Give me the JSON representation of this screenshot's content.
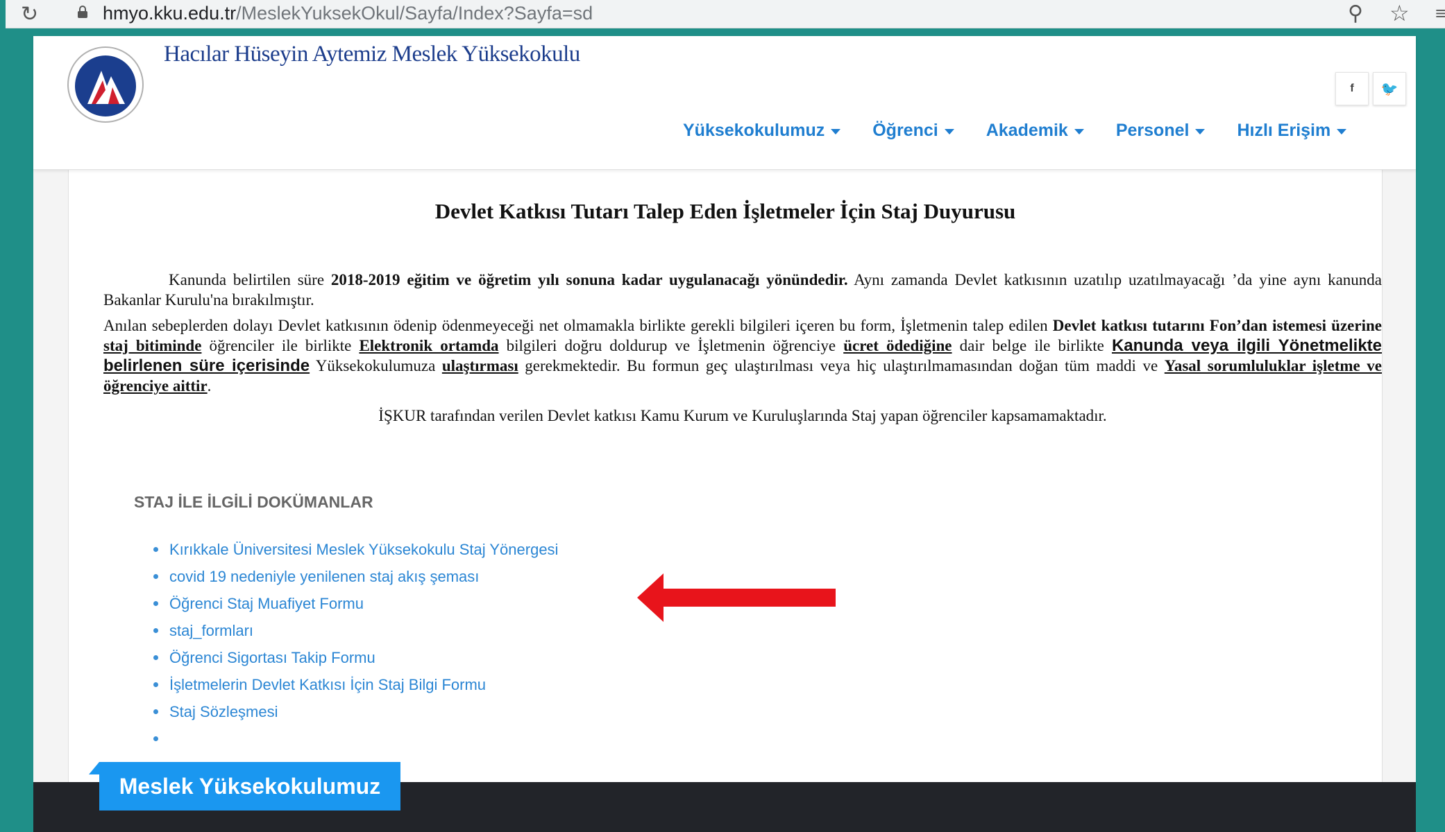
{
  "browser": {
    "url_host": "hmyo.kku.edu.tr",
    "url_path": "/MeslekYuksekOkul/Sayfa/Index?Sayfa=sd",
    "reload_icon": "reload-icon",
    "zoom_icon": "zoom-icon",
    "star_icon": "star-icon"
  },
  "header": {
    "school_name": "Hacılar Hüseyin Aytemiz Meslek Yüksekokulu",
    "social": {
      "facebook": "f",
      "twitter": "🐦"
    },
    "nav": [
      {
        "label": "Yüksekokulumuz"
      },
      {
        "label": "Öğrenci"
      },
      {
        "label": "Akademik"
      },
      {
        "label": "Personel"
      },
      {
        "label": "Hızlı Erişim"
      }
    ]
  },
  "content": {
    "title": "Devlet Katkısı Tutarı Talep Eden İşletmeler İçin Staj Duyurusu",
    "p1": {
      "a": "Kanunda belirtilen süre ",
      "b": "2018-2019 eğitim ve öğretim yılı sonuna kadar uygulanacağı yönündedir.",
      "c": " Aynı zamanda Devlet katkısının uzatılıp uzatılmayacağı ’da yine aynı kanunda Bakanlar Kurulu'na bırakılmıştır."
    },
    "p2": {
      "a": "Anılan sebeplerden dolayı Devlet katkısının ödenip ödenmeyeceği net olmamakla birlikte gerekli  bilgileri içeren bu form, İşletmenin talep edilen ",
      "b": "Devlet katkısı tutarını Fon’dan istemesi üzerine",
      "c": " staj bitiminde",
      "d": " öğrenciler ile birlikte ",
      "e": "Elektronik ortamda",
      "f": " bilgileri doğru doldurup ve İşletmenin öğrenciye ",
      "g": "ücret ödediğine",
      "h": " dair belge ile birlikte ",
      "i": "Kanunda veya ilgili Yönetmelikte belirlenen süre içerisinde",
      "j": " Yüksekokulumuza ",
      "k": "ulaştırması",
      "l": " gerekmektedir. Bu formun geç ulaştırılması veya hiç ulaştırılmamasından doğan tüm maddi ve ",
      "m": "Yasal sorumluluklar işletme ve öğrenciye aittir",
      "n": "."
    },
    "p3": "İŞKUR tarafından verilen Devlet katkısı Kamu Kurum ve Kuruluşlarında Staj yapan öğrenciler kapsamamaktadır.",
    "docs_heading": "STAJ İLE İLGİLİ DOKÜMANLAR",
    "docs": [
      "Kırıkkale Üniversitesi Meslek Yüksekokulu Staj Yönergesi",
      "covid 19 nedeniyle yenilenen staj akış şeması",
      "Öğrenci Staj Muafiyet Formu",
      "staj_formları",
      "Öğrenci Sigortası Takip Formu",
      "İşletmelerin Devlet Katkısı İçin Staj Bilgi Formu",
      "Staj Sözleşmesi",
      ""
    ]
  },
  "footer": {
    "tab_label": "Meslek Yüksekokulumuz"
  },
  "colors": {
    "nav": "#1f7ed0",
    "link": "#2b86d4",
    "footer_tab": "#1a97f0",
    "arrow": "#e8141b"
  }
}
